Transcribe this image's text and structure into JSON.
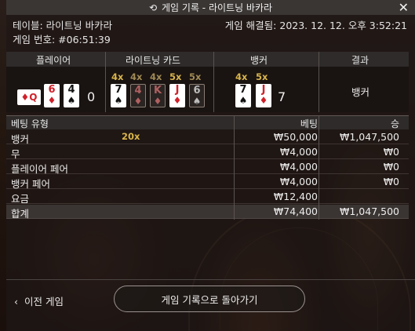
{
  "window": {
    "title": "게임 기록 - 라이트닝 바카라"
  },
  "meta": {
    "table_label": "테이블: 라이트닝 바카라",
    "game_number": "게임 번호: #06:51:39",
    "resolved": "게임 해결됨: 2023. 12. 12. 오후 3:52:21"
  },
  "results": {
    "headers": {
      "player": "플레이어",
      "lightning": "라이트닝 카드",
      "banker": "뱅커",
      "result": "결과"
    },
    "player_cards": [
      {
        "rank": "6",
        "suit": "♦",
        "color": "red"
      },
      {
        "rank": "4",
        "suit": "♠",
        "color": "black"
      }
    ],
    "player_side_card": {
      "rank": "Q",
      "suit": "♦",
      "color": "red"
    },
    "player_score": "0",
    "lightning_multipliers": [
      "4x",
      "4x",
      "4x",
      "5x",
      "5x"
    ],
    "lightning_cards": [
      {
        "rank": "7",
        "suit": "♠"
      },
      {
        "rank": "4",
        "suit": "♦"
      },
      {
        "rank": "K",
        "suit": "♦"
      },
      {
        "rank": "J",
        "suit": "♦"
      },
      {
        "rank": "6",
        "suit": "♠"
      }
    ],
    "banker_multipliers": [
      "4x",
      "5x"
    ],
    "banker_cards": [
      {
        "rank": "7",
        "suit": "♠",
        "color": "black"
      },
      {
        "rank": "J",
        "suit": "♦",
        "color": "red"
      }
    ],
    "banker_score": "7",
    "outcome": "뱅커"
  },
  "bets": {
    "headers": {
      "type": "베팅 유형",
      "bet": "베팅",
      "win": "승"
    },
    "rows": [
      {
        "name": "뱅커",
        "multiplier": "20x",
        "bet": "₩50,000",
        "win": "₩1,047,500"
      },
      {
        "name": "무",
        "multiplier": "",
        "bet": "₩4,000",
        "win": "₩0"
      },
      {
        "name": "플레이어 페어",
        "multiplier": "",
        "bet": "₩4,000",
        "win": "₩0"
      },
      {
        "name": "뱅커 페어",
        "multiplier": "",
        "bet": "₩4,000",
        "win": "₩0"
      },
      {
        "name": "요금",
        "multiplier": "",
        "bet": "₩12,400",
        "win": ""
      }
    ],
    "total": {
      "name": "합계",
      "bet": "₩74,400",
      "win": "₩1,047,500"
    }
  },
  "footer": {
    "prev_game": "이전 게임",
    "back_to_history": "게임 기록으로 돌아가기"
  },
  "colors": {
    "gold": "#d8b54a",
    "red_card": "#d0212a",
    "multiplier_dim": "#a08a55"
  }
}
